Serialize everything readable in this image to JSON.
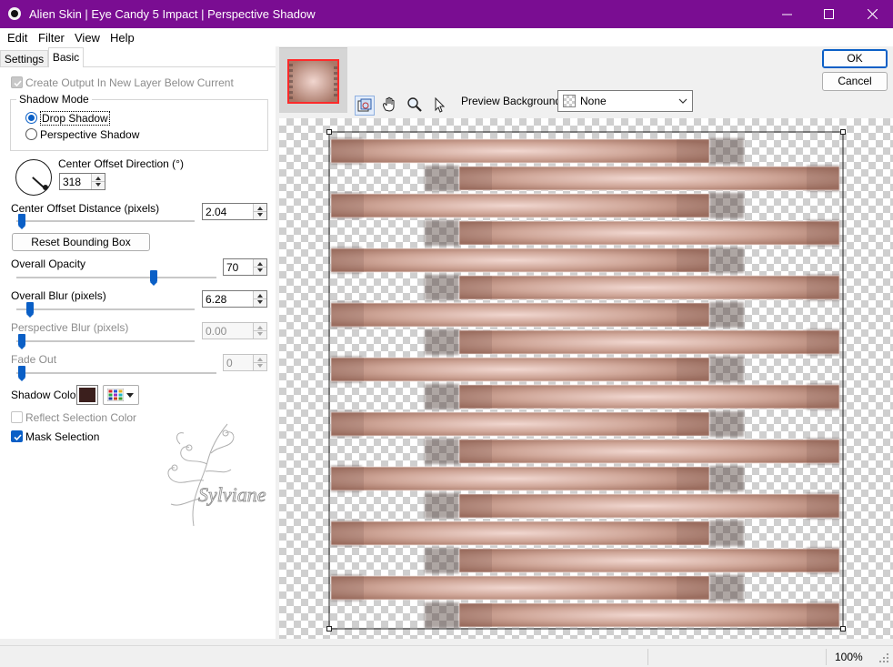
{
  "window": {
    "title": "Alien Skin | Eye Candy 5 Impact | Perspective Shadow",
    "controls": [
      "minimize-icon",
      "maximize-icon",
      "close-icon"
    ],
    "accent_color": "#7a0d92"
  },
  "menu": {
    "items": [
      "Edit",
      "Filter",
      "View",
      "Help"
    ]
  },
  "tabs": {
    "items": [
      "Settings",
      "Basic"
    ],
    "selected": "Basic"
  },
  "basic": {
    "create_output": {
      "label": "Create Output In New Layer Below Current",
      "checked": true,
      "enabled": false
    },
    "shadow_mode": {
      "legend": "Shadow Mode",
      "options": [
        "Drop Shadow",
        "Perspective Shadow"
      ],
      "selected": "Drop Shadow"
    },
    "center_offset_direction": {
      "label": "Center Offset Direction (°)",
      "value": "318",
      "angle_degrees": 318
    },
    "center_offset_distance": {
      "label": "Center Offset Distance (pixels)",
      "value": "2.04",
      "slider_fraction": 0.02
    },
    "reset_bounding_box": {
      "label": "Reset Bounding Box"
    },
    "overall_opacity": {
      "label": "Overall Opacity",
      "value": "70",
      "slider_fraction": 0.7
    },
    "overall_blur": {
      "label": "Overall Blur (pixels)",
      "value": "6.28",
      "slider_fraction": 0.06
    },
    "perspective_blur": {
      "label": "Perspective Blur (pixels)",
      "value": "0.00",
      "enabled": false,
      "slider_fraction": 0.0
    },
    "fade_out": {
      "label": "Fade Out",
      "value": "0",
      "enabled": false,
      "slider_fraction": 0.0
    },
    "shadow_color": {
      "label": "Shadow Color",
      "color": "#3b1f1d"
    },
    "reflect_selection_color": {
      "label": "Reflect Selection Color",
      "checked": false,
      "enabled": false
    },
    "mask_selection": {
      "label": "Mask Selection",
      "checked": true
    }
  },
  "watermark": {
    "text": "Sylviane"
  },
  "preview": {
    "background_label": "Preview Background:",
    "background_value": "None",
    "tools": [
      "navigator-icon",
      "hand-icon",
      "zoom-icon",
      "pointer-icon"
    ]
  },
  "buttons": {
    "ok": "OK",
    "cancel": "Cancel"
  },
  "status": {
    "zoom": "100%"
  }
}
